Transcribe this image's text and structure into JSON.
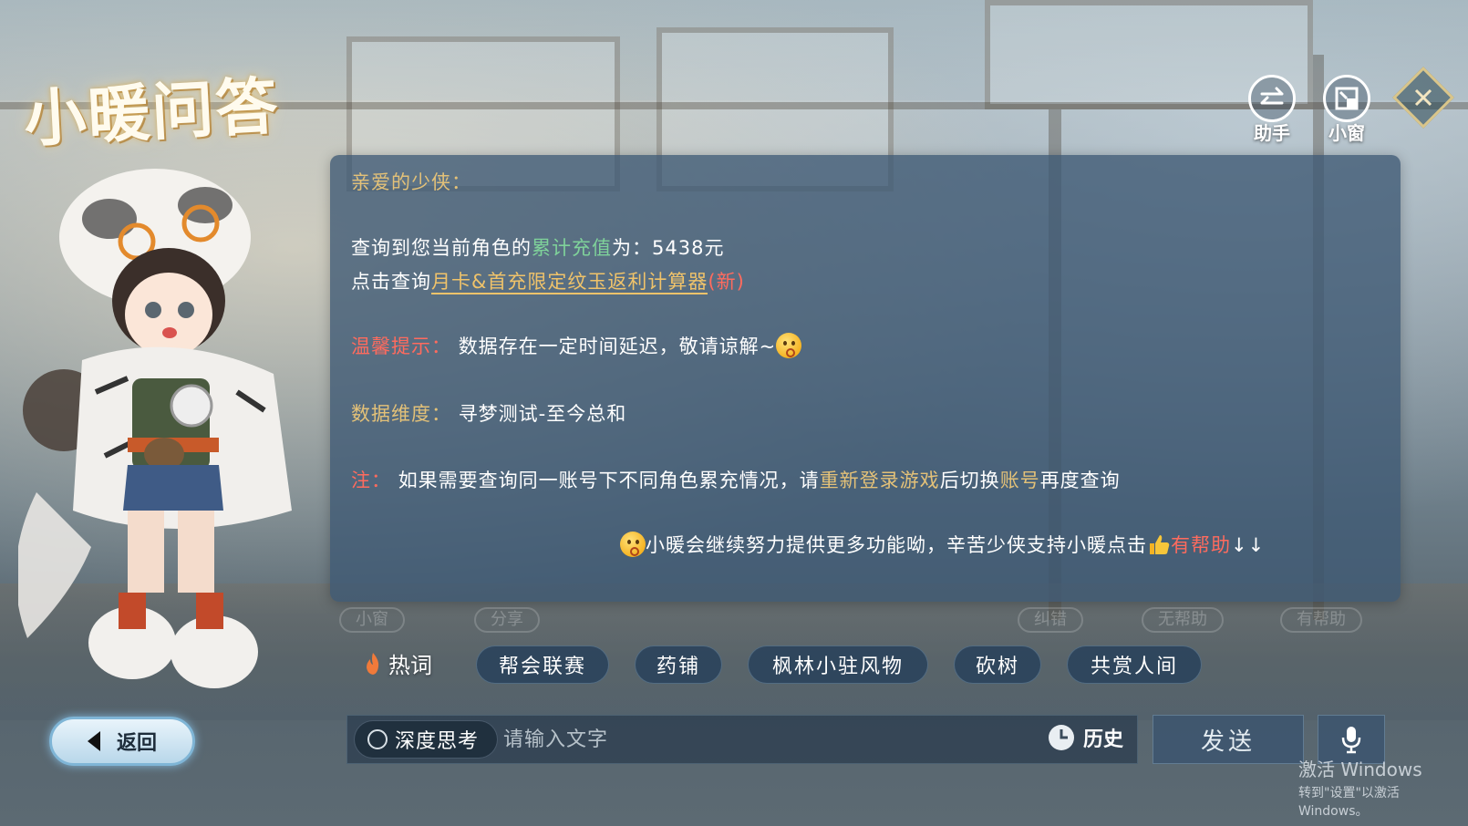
{
  "app": {
    "title": "小暖问答"
  },
  "top_buttons": {
    "assistant_label": "助手",
    "mini_window_label": "小窗"
  },
  "message": {
    "greeting": "亲爱的少侠：",
    "query_prefix": "查询到您当前角色的",
    "query_highlight": "累计充值",
    "query_suffix": "为：",
    "recharge_amount": "5438元",
    "calc_prefix": "点击查询",
    "calc_link": "月卡&首充限定纹玉返利计算器",
    "calc_new": "(新)",
    "tip_label": "温馨提示：",
    "tip_text": "数据存在一定时间延迟，敬请谅解~",
    "dimension_label": "数据维度：",
    "dimension_value": "寻梦测试-至今总和",
    "note_label": "注：",
    "note_text_1": "如果需要查询同一账号下不同角色累充情况，请",
    "note_highlight_1": "重新登录游戏",
    "note_text_2": "后切换",
    "note_highlight_2": "账号",
    "note_text_3": "再度查询",
    "footer_text": "小暖会继续努力提供更多功能呦，辛苦少侠支持小暖点击",
    "footer_helpful": "有帮助",
    "footer_arrows": "↓↓"
  },
  "faded_actions": [
    "小窗",
    "分享",
    "纠错",
    "无帮助",
    "有帮助"
  ],
  "hot_words": {
    "label": "热词",
    "chips": [
      "帮会联赛",
      "药铺",
      "枫林小驻风物",
      "砍树",
      "共赏人间"
    ]
  },
  "input_bar": {
    "back_label": "返回",
    "deep_think_label": "深度思考",
    "placeholder": "请输入文字",
    "history_label": "历史",
    "send_label": "发送"
  },
  "watermark": {
    "line1": "激活 Windows",
    "line2": "转到\"设置\"以激活 Windows。"
  },
  "colors": {
    "panel_bg": "#3e5873",
    "gold": "#e3c178",
    "green": "#7fd29a",
    "red": "#ff6b5e"
  }
}
